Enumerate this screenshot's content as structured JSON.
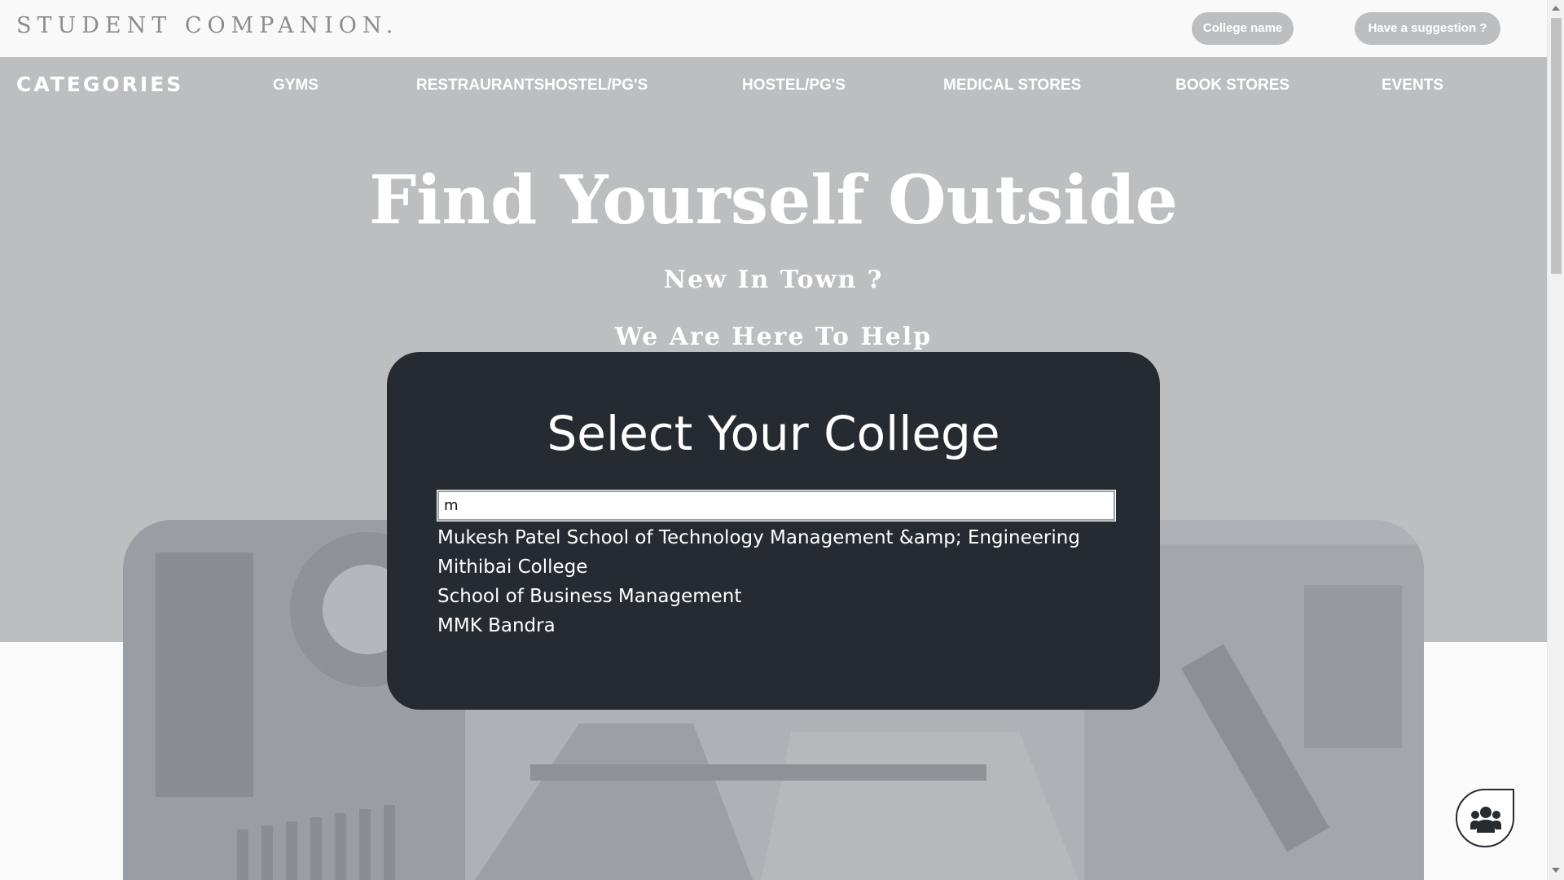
{
  "header": {
    "brand": "STUDENT COMPANION.",
    "college_button": "College name",
    "suggestion_button": "Have a suggestion ?"
  },
  "nav": {
    "title": "CATEGORIES",
    "items": [
      {
        "label": "GYMS"
      },
      {
        "label": "RESTRAURANTSHOSTEL/PG'S"
      },
      {
        "label": "HOSTEL/PG'S"
      },
      {
        "label": "MEDICAL STORES"
      },
      {
        "label": "BOOK STORES"
      },
      {
        "label": "EVENTS"
      }
    ]
  },
  "hero": {
    "headline": "Find Yourself Outside",
    "subtitle": "New In Town ?",
    "tagline": "We Are Here To Help"
  },
  "modal": {
    "title": "Select Your College",
    "input_value": "m",
    "suggestions": [
      "Mukesh Patel School of Technology Management &amp; Engineering",
      "Mithibai College",
      "School of Business Management",
      "MMK Bandra"
    ]
  },
  "icons": {
    "fab": "users-group-icon"
  },
  "colors": {
    "hero_background": "#bdbec0",
    "modal_background": "#262a31",
    "page_background": "#fafafa",
    "brand_text": "#8c8c8c"
  }
}
